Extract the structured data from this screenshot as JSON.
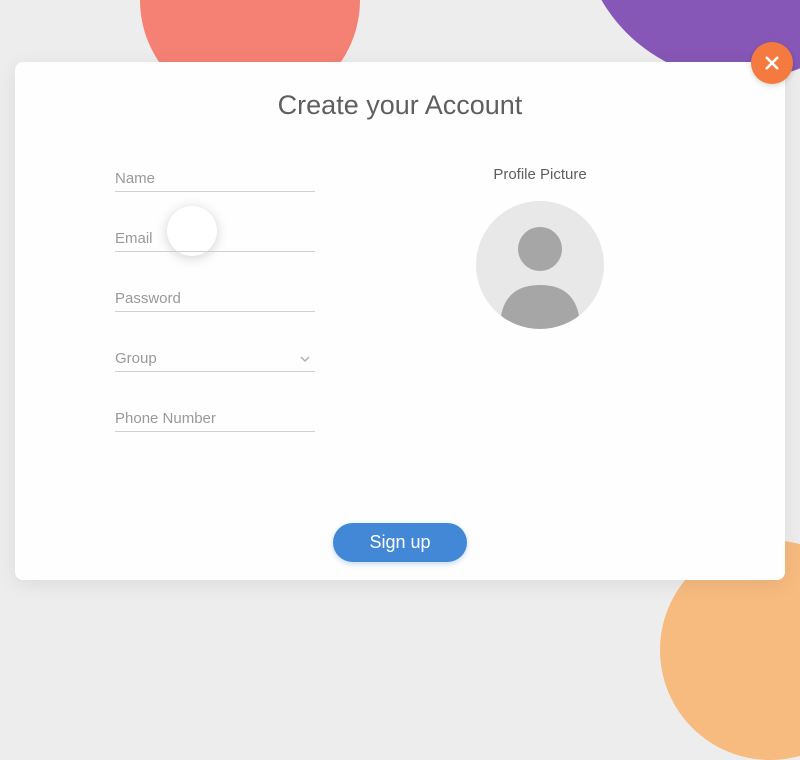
{
  "modal": {
    "title": "Create your Account",
    "fields": {
      "name": {
        "placeholder": "Name",
        "value": ""
      },
      "email": {
        "placeholder": "Email",
        "value": ""
      },
      "password": {
        "placeholder": "Password",
        "value": ""
      },
      "group": {
        "placeholder": "Group",
        "value": ""
      },
      "phone": {
        "placeholder": "Phone Number",
        "value": ""
      }
    },
    "profile_label": "Profile Picture",
    "submit_label": "Sign up"
  }
}
